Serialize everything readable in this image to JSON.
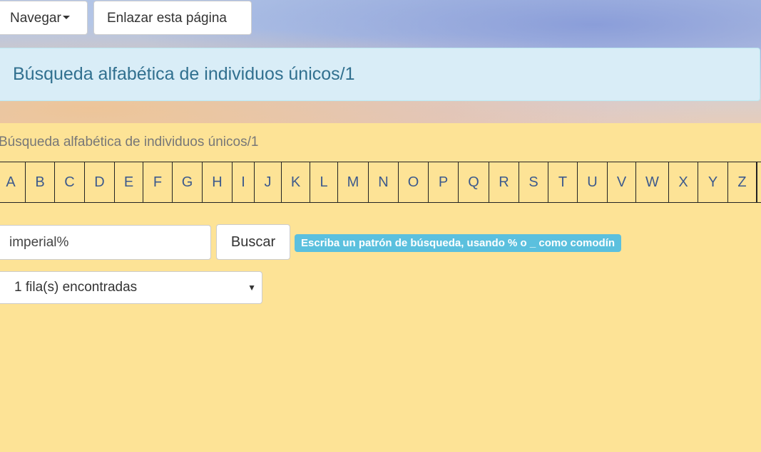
{
  "nav": {
    "browse_label": "Navegar",
    "link_label": "Enlazar esta página"
  },
  "page": {
    "title": "Búsqueda alfabética de individuos únicos/1",
    "subtitle": "Búsqueda alfabética de individuos únicos/1"
  },
  "alphabet": [
    "A",
    "B",
    "C",
    "D",
    "E",
    "F",
    "G",
    "H",
    "I",
    "J",
    "K",
    "L",
    "M",
    "N",
    "O",
    "P",
    "Q",
    "R",
    "S",
    "T",
    "U",
    "V",
    "W",
    "X",
    "Y",
    "Z"
  ],
  "search": {
    "value": "imperial%",
    "button_label": "Buscar",
    "hint": "Escriba un patrón de búsqueda, usando % o _ como comodín"
  },
  "results": {
    "selected": "1 fila(s) encontradas"
  },
  "icons": {
    "dropdown": "caret-down-icon",
    "select": "chevron-down-icon"
  },
  "colors": {
    "background": "#fde396",
    "title_panel": "#d9edf7",
    "title_text": "#31708f",
    "hint_badge": "#5bc0de",
    "letter_link": "#3d5a8c"
  }
}
